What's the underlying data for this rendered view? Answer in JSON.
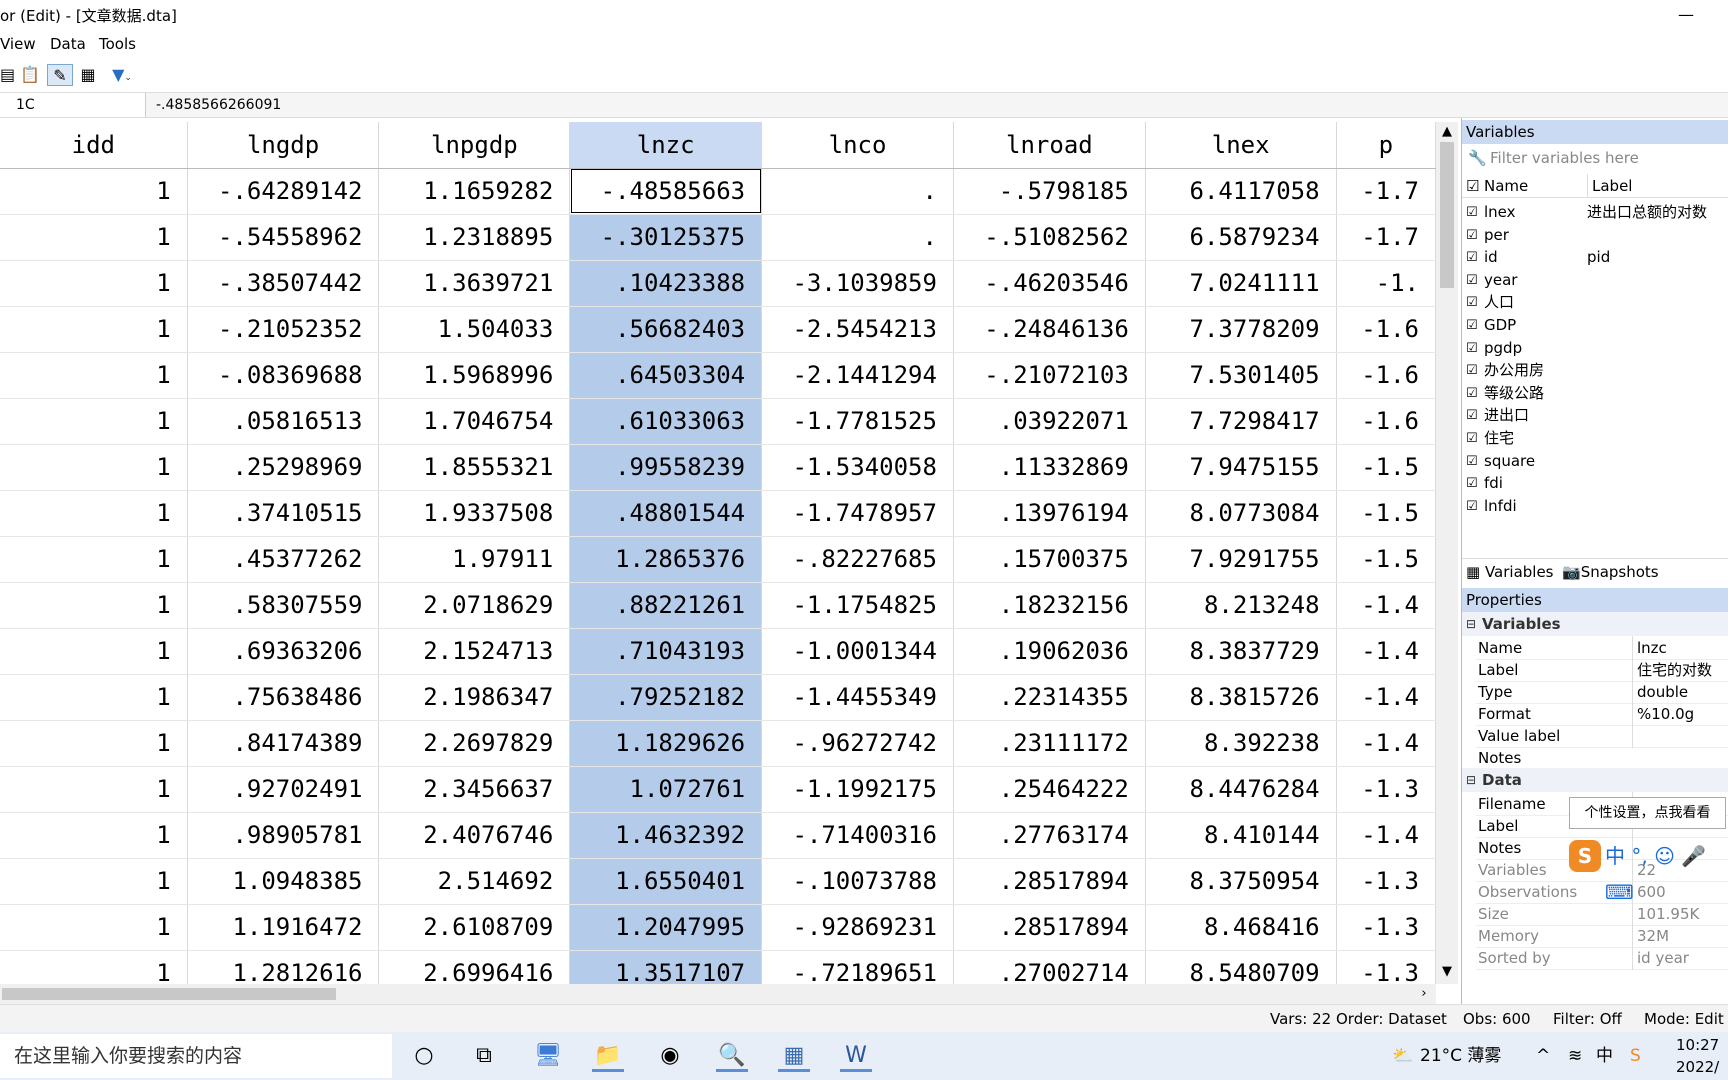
{
  "window": {
    "title": "or (Edit) - [文章数据.dta]",
    "minimize_glyph": "—"
  },
  "menu": [
    "View",
    "Data",
    "Tools"
  ],
  "toolbar": {
    "icons": [
      "paste-icon",
      "clipboard-icon",
      "edit-icon",
      "grid-icon",
      "filter-icon"
    ]
  },
  "formula": {
    "cell_ref": "1C",
    "value": "-.4858566266091"
  },
  "grid": {
    "columns": [
      "idd",
      "lngdp",
      "lnpgdp",
      "lnzc",
      "lnco",
      "lnroad",
      "lnex",
      "p"
    ],
    "selected_column": 3,
    "rows": [
      [
        "1",
        "-.64289142",
        "1.1659282",
        "-.48585663",
        ".",
        "-.5798185",
        "6.4117058",
        "-1.7"
      ],
      [
        "1",
        "-.54558962",
        "1.2318895",
        "-.30125375",
        ".",
        "-.51082562",
        "6.5879234",
        "-1.7"
      ],
      [
        "1",
        "-.38507442",
        "1.3639721",
        ".10423388",
        "-3.1039859",
        "-.46203546",
        "7.0241111",
        "-1."
      ],
      [
        "1",
        "-.21052352",
        "1.504033",
        ".56682403",
        "-2.5454213",
        "-.24846136",
        "7.3778209",
        "-1.6"
      ],
      [
        "1",
        "-.08369688",
        "1.5968996",
        ".64503304",
        "-2.1441294",
        "-.21072103",
        "7.5301405",
        "-1.6"
      ],
      [
        "1",
        ".05816513",
        "1.7046754",
        ".61033063",
        "-1.7781525",
        ".03922071",
        "7.7298417",
        "-1.6"
      ],
      [
        "1",
        ".25298969",
        "1.8555321",
        ".99558239",
        "-1.5340058",
        ".11332869",
        "7.9475155",
        "-1.5"
      ],
      [
        "1",
        ".37410515",
        "1.9337508",
        ".48801544",
        "-1.7478957",
        ".13976194",
        "8.0773084",
        "-1.5"
      ],
      [
        "1",
        ".45377262",
        "1.97911",
        "1.2865376",
        "-.82227685",
        ".15700375",
        "7.9291755",
        "-1.5"
      ],
      [
        "1",
        ".58307559",
        "2.0718629",
        ".88221261",
        "-1.1754825",
        ".18232156",
        "8.213248",
        "-1.4"
      ],
      [
        "1",
        ".69363206",
        "2.1524713",
        ".71043193",
        "-1.0001344",
        ".19062036",
        "8.3837729",
        "-1.4"
      ],
      [
        "1",
        ".75638486",
        "2.1986347",
        ".79252182",
        "-1.4455349",
        ".22314355",
        "8.3815726",
        "-1.4"
      ],
      [
        "1",
        ".84174389",
        "2.2697829",
        "1.1829626",
        "-.96272742",
        ".23111172",
        "8.392238",
        "-1.4"
      ],
      [
        "1",
        ".92702491",
        "2.3456637",
        "1.072761",
        "-1.1992175",
        ".25464222",
        "8.4476284",
        "-1.3"
      ],
      [
        "1",
        ".98905781",
        "2.4076746",
        "1.4632392",
        "-.71400316",
        ".27763174",
        "8.410144",
        "-1.4"
      ],
      [
        "1",
        "1.0948385",
        "2.514692",
        "1.6550401",
        "-.10073788",
        ".28517894",
        "8.3750954",
        "-1.3"
      ],
      [
        "1",
        "1.1916472",
        "2.6108709",
        "1.2047995",
        "-.92869231",
        ".28517894",
        "8.468416",
        "-1.3"
      ],
      [
        "1",
        "1.2812616",
        "2.6996416",
        "1.3517107",
        "-.72189651",
        ".27002714",
        "8.5480709",
        "-1.3"
      ]
    ]
  },
  "variables_panel": {
    "title": "Variables",
    "filter_placeholder": "Filter variables here",
    "col_name": "Name",
    "col_label": "Label",
    "items": [
      {
        "name": "lnex",
        "label": "进出口总额的对数"
      },
      {
        "name": "per",
        "label": ""
      },
      {
        "name": "id",
        "label": "pid"
      },
      {
        "name": "year",
        "label": ""
      },
      {
        "name": "人口",
        "label": ""
      },
      {
        "name": "GDP",
        "label": ""
      },
      {
        "name": "pgdp",
        "label": ""
      },
      {
        "name": "办公用房",
        "label": ""
      },
      {
        "name": "等级公路",
        "label": ""
      },
      {
        "name": "进出口",
        "label": ""
      },
      {
        "name": "住宅",
        "label": ""
      },
      {
        "name": "square",
        "label": ""
      },
      {
        "name": "fdi",
        "label": ""
      },
      {
        "name": "lnfdi",
        "label": ""
      }
    ],
    "tab_variables": "Variables",
    "tab_snapshots": "Snapshots"
  },
  "properties_panel": {
    "title": "Properties",
    "section_variables": "Variables",
    "var_props": [
      {
        "k": "Name",
        "v": "lnzc"
      },
      {
        "k": "Label",
        "v": "住宅的对数"
      },
      {
        "k": "Type",
        "v": "double"
      },
      {
        "k": "Format",
        "v": "%10.0g"
      },
      {
        "k": "Value label",
        "v": ""
      }
    ],
    "notes": "Notes",
    "section_data": "Data",
    "data_props": [
      {
        "k": "Filename",
        "v": ""
      },
      {
        "k": "Label",
        "v": ""
      },
      {
        "k": "Notes",
        "v": ""
      },
      {
        "k": "Variables",
        "v": "22"
      },
      {
        "k": "Observations",
        "v": "600"
      },
      {
        "k": "Size",
        "v": "101.95K"
      },
      {
        "k": "Memory",
        "v": "32M"
      },
      {
        "k": "Sorted by",
        "v": "id year"
      }
    ]
  },
  "tooltip": "个性设置，点我看看",
  "ime": {
    "logo": "S",
    "text": "中 °, ☺ 🎤 ⌨"
  },
  "status": {
    "vars": "Vars: 22",
    "order": "Order: Dataset",
    "obs": "Obs: 600",
    "filter": "Filter: Off",
    "mode": "Mode: Edit"
  },
  "taskbar": {
    "search_placeholder": "在这里输入你要搜索的内容",
    "weather": "21°C 薄雾",
    "time": "10:27",
    "date": "2022/"
  }
}
